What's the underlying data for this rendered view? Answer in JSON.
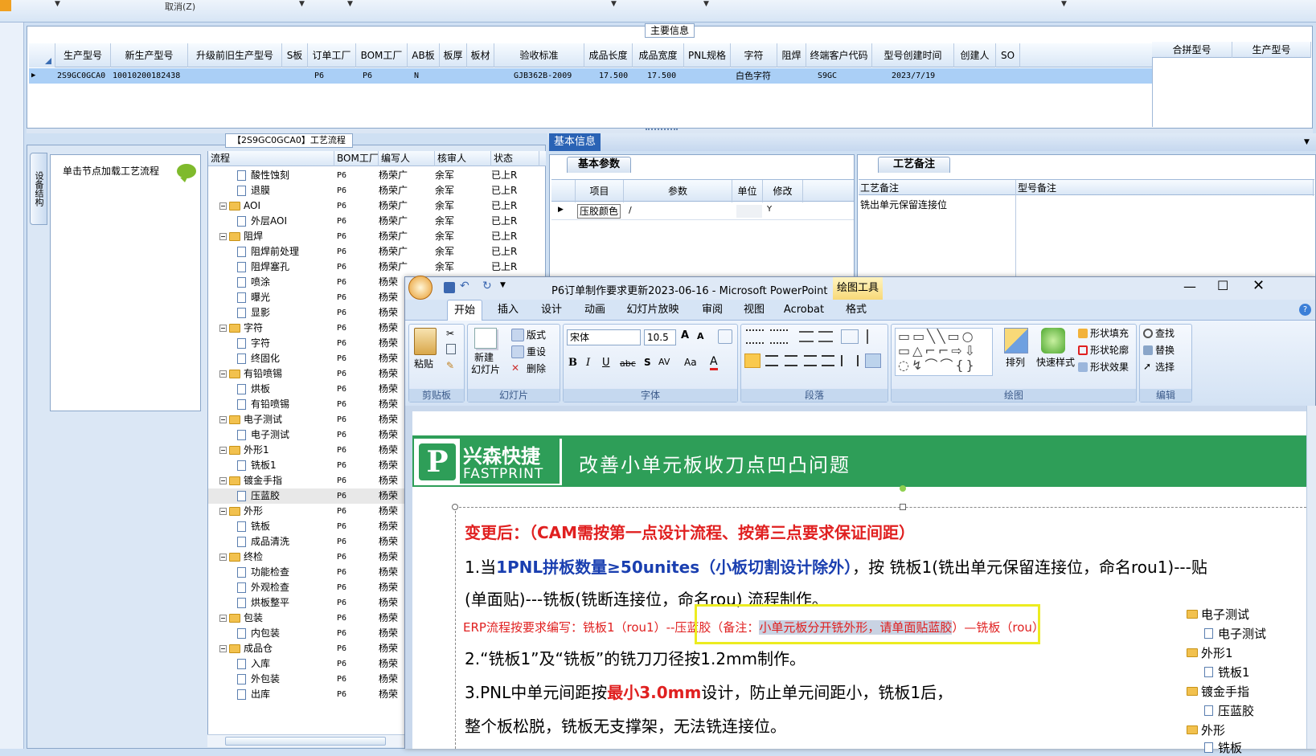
{
  "topbar": {
    "cancel_label": "取消(Z)"
  },
  "main_info": {
    "legend": "主要信息",
    "columns": [
      "生产型号",
      "新生产型号",
      "升级前旧生产型号",
      "S板",
      "订单工厂",
      "BOM工厂",
      "AB板",
      "板厚",
      "板材",
      "验收标准",
      "成品长度",
      "成品宽度",
      "PNL规格",
      "字符",
      "阻焊",
      "终端客户代码",
      "型号创建时间",
      "创建人",
      "SO"
    ],
    "row": {
      "c0": "2S9GC0GCA0",
      "c1": "10010200182438",
      "c4": "P6",
      "c5": "P6",
      "c6": "N",
      "c9": "GJB362B-2009",
      "c10": "17.500",
      "c11": "17.500",
      "c13": "白色字符",
      "c15": "S9GC",
      "c16": "2023/7/19"
    },
    "merge_columns": [
      "合拼型号",
      "生产型号"
    ]
  },
  "flow": {
    "legend": "【2S9GC0GCA0】工艺流程",
    "side_tab": "设备结构",
    "node_hint": "单击节点加载工艺流程",
    "columns": [
      "流程",
      "BOM工厂",
      "编写人",
      "核审人",
      "状态"
    ],
    "rows": [
      {
        "name": "酸性蚀刻",
        "lvl": 2,
        "f": "P6",
        "w": "杨荣广",
        "r": "余军",
        "s": "已上R"
      },
      {
        "name": "退膜",
        "lvl": 2,
        "f": "P6",
        "w": "杨荣广",
        "r": "余军",
        "s": "已上R"
      },
      {
        "name": "AOI",
        "lvl": 1,
        "f": "P6",
        "w": "杨荣广",
        "r": "余军",
        "s": "已上R"
      },
      {
        "name": "外层AOI",
        "lvl": 2,
        "f": "P6",
        "w": "杨荣广",
        "r": "余军",
        "s": "已上R"
      },
      {
        "name": "阻焊",
        "lvl": 1,
        "f": "P6",
        "w": "杨荣广",
        "r": "余军",
        "s": "已上R"
      },
      {
        "name": "阻焊前处理",
        "lvl": 2,
        "f": "P6",
        "w": "杨荣广",
        "r": "余军",
        "s": "已上R"
      },
      {
        "name": "阻焊塞孔",
        "lvl": 2,
        "f": "P6",
        "w": "杨荣广",
        "r": "余军",
        "s": "已上R"
      },
      {
        "name": "喷涂",
        "lvl": 2,
        "f": "P6",
        "w": "杨荣",
        "r": "",
        "s": ""
      },
      {
        "name": "曝光",
        "lvl": 2,
        "f": "P6",
        "w": "杨荣",
        "r": "",
        "s": ""
      },
      {
        "name": "显影",
        "lvl": 2,
        "f": "P6",
        "w": "杨荣",
        "r": "",
        "s": ""
      },
      {
        "name": "字符",
        "lvl": 1,
        "f": "P6",
        "w": "杨荣",
        "r": "",
        "s": ""
      },
      {
        "name": "字符",
        "lvl": 2,
        "f": "P6",
        "w": "杨荣",
        "r": "",
        "s": ""
      },
      {
        "name": "终固化",
        "lvl": 2,
        "f": "P6",
        "w": "杨荣",
        "r": "",
        "s": ""
      },
      {
        "name": "有铅喷锡",
        "lvl": 1,
        "f": "P6",
        "w": "杨荣",
        "r": "",
        "s": ""
      },
      {
        "name": "烘板",
        "lvl": 2,
        "f": "P6",
        "w": "杨荣",
        "r": "",
        "s": ""
      },
      {
        "name": "有铅喷锡",
        "lvl": 2,
        "f": "P6",
        "w": "杨荣",
        "r": "",
        "s": ""
      },
      {
        "name": "电子测试",
        "lvl": 1,
        "f": "P6",
        "w": "杨荣",
        "r": "",
        "s": ""
      },
      {
        "name": "电子测试",
        "lvl": 2,
        "f": "P6",
        "w": "杨荣",
        "r": "",
        "s": ""
      },
      {
        "name": "外形1",
        "lvl": 1,
        "f": "P6",
        "w": "杨荣",
        "r": "",
        "s": ""
      },
      {
        "name": "铣板1",
        "lvl": 2,
        "f": "P6",
        "w": "杨荣",
        "r": "",
        "s": ""
      },
      {
        "name": "镀金手指",
        "lvl": 1,
        "f": "P6",
        "w": "杨荣",
        "r": "",
        "s": ""
      },
      {
        "name": "压蓝胶",
        "lvl": 2,
        "f": "P6",
        "w": "杨荣",
        "r": "",
        "s": ""
      },
      {
        "name": "外形",
        "lvl": 1,
        "f": "P6",
        "w": "杨荣",
        "r": "",
        "s": ""
      },
      {
        "name": "铣板",
        "lvl": 2,
        "f": "P6",
        "w": "杨荣",
        "r": "",
        "s": ""
      },
      {
        "name": "成品清洗",
        "lvl": 2,
        "f": "P6",
        "w": "杨荣",
        "r": "",
        "s": ""
      },
      {
        "name": "终检",
        "lvl": 1,
        "f": "P6",
        "w": "杨荣",
        "r": "",
        "s": ""
      },
      {
        "name": "功能检查",
        "lvl": 2,
        "f": "P6",
        "w": "杨荣",
        "r": "",
        "s": ""
      },
      {
        "name": "外观检查",
        "lvl": 2,
        "f": "P6",
        "w": "杨荣",
        "r": "",
        "s": ""
      },
      {
        "name": "烘板整平",
        "lvl": 2,
        "f": "P6",
        "w": "杨荣",
        "r": "",
        "s": ""
      },
      {
        "name": "包装",
        "lvl": 1,
        "f": "P6",
        "w": "杨荣",
        "r": "",
        "s": ""
      },
      {
        "name": "内包装",
        "lvl": 2,
        "f": "P6",
        "w": "杨荣",
        "r": "",
        "s": ""
      },
      {
        "name": "成品仓",
        "lvl": 1,
        "f": "P6",
        "w": "杨荣",
        "r": "",
        "s": ""
      },
      {
        "name": "入库",
        "lvl": 2,
        "f": "P6",
        "w": "杨荣",
        "r": "",
        "s": ""
      },
      {
        "name": "外包装",
        "lvl": 2,
        "f": "P6",
        "w": "杨荣",
        "r": "",
        "s": ""
      },
      {
        "name": "出库",
        "lvl": 2,
        "f": "P6",
        "w": "杨荣",
        "r": "",
        "s": ""
      }
    ]
  },
  "basic": {
    "tab": "基本信息",
    "params_tab": "基本参数",
    "columns": [
      "项目",
      "参数",
      "单位",
      "修改"
    ],
    "row": {
      "item": "压胶颜色",
      "param": "/",
      "unit": "",
      "mod": "Y"
    }
  },
  "process_note": {
    "tab": "工艺备注",
    "col1": "工艺备注",
    "col2": "型号备注",
    "note": "铣出单元保留连接位"
  },
  "ppt": {
    "title": "P6订单制作要求更新2023-06-16 - Microsoft PowerPoint",
    "tool_context": "绘图工具",
    "tabs": [
      "开始",
      "插入",
      "设计",
      "动画",
      "幻灯片放映",
      "审阅",
      "视图",
      "Acrobat",
      "格式"
    ],
    "groups": {
      "clipboard": {
        "label": "剪贴板",
        "paste": "粘贴"
      },
      "slides": {
        "label": "幻灯片",
        "new_slide_1": "新建",
        "new_slide_2": "幻灯片",
        "layout": "版式",
        "reset": "重设",
        "delete": "删除"
      },
      "font": {
        "label": "字体",
        "font_name": "宋体",
        "font_size": "10.5"
      },
      "paragraph": {
        "label": "段落"
      },
      "drawing": {
        "label": "绘图",
        "arrange": "排列",
        "quick_styles": "快速样式",
        "fill": "形状填充",
        "outline": "形状轮廓",
        "effects": "形状效果"
      },
      "editing": {
        "label": "编辑",
        "find": "查找",
        "replace": "替换",
        "select": "选择"
      }
    },
    "slide": {
      "logo_cn": "兴森快捷",
      "logo_en": "FASTPRINT",
      "title": "改善小单元板收刀点凹凸问题",
      "line1": "变更后：（CAM需按第一点设计流程、按第三点要求保证间距）",
      "line2a": "1.当",
      "line2b": "1PNL拼板数量≥50unites（小板切割设计除外）",
      "line2c": "，按 铣板1(铣出单元保留连接位，命名rou1)---贴",
      "line3": "(单面贴)---铣板(铣断连接位，命名rou) 流程制作。",
      "line4a": "ERP流程按要求编写：铣板1（rou1）",
      "line4b": "--压蓝胶（备注：",
      "line4c": "小单元板分开铣外形，请单面贴蓝胶",
      "line4d": "）",
      "line4e": "—铣板（rou）",
      "line5": "2.“铣板1”及“铣板”的铣刀刀径按1.2mm制作。",
      "line6a": "3.PNL中单元间距按",
      "line6b": "最小3.0mm",
      "line6c": "设计，防止单元间距小，铣板1后，",
      "line7": "整个板松脱，铣板无支撑架，无法铣连接位。",
      "mini_tree": [
        "电子测试",
        "电子测试",
        "外形1",
        "铣板1",
        "镀金手指",
        "压蓝胶",
        "外形",
        "铣板"
      ]
    }
  },
  "colors": {
    "accent": "#2a63b5",
    "selected_row": "#aacff6",
    "banner": "#2e9e58",
    "red_text": "#e02020",
    "blue_text": "#1a3fb0"
  }
}
